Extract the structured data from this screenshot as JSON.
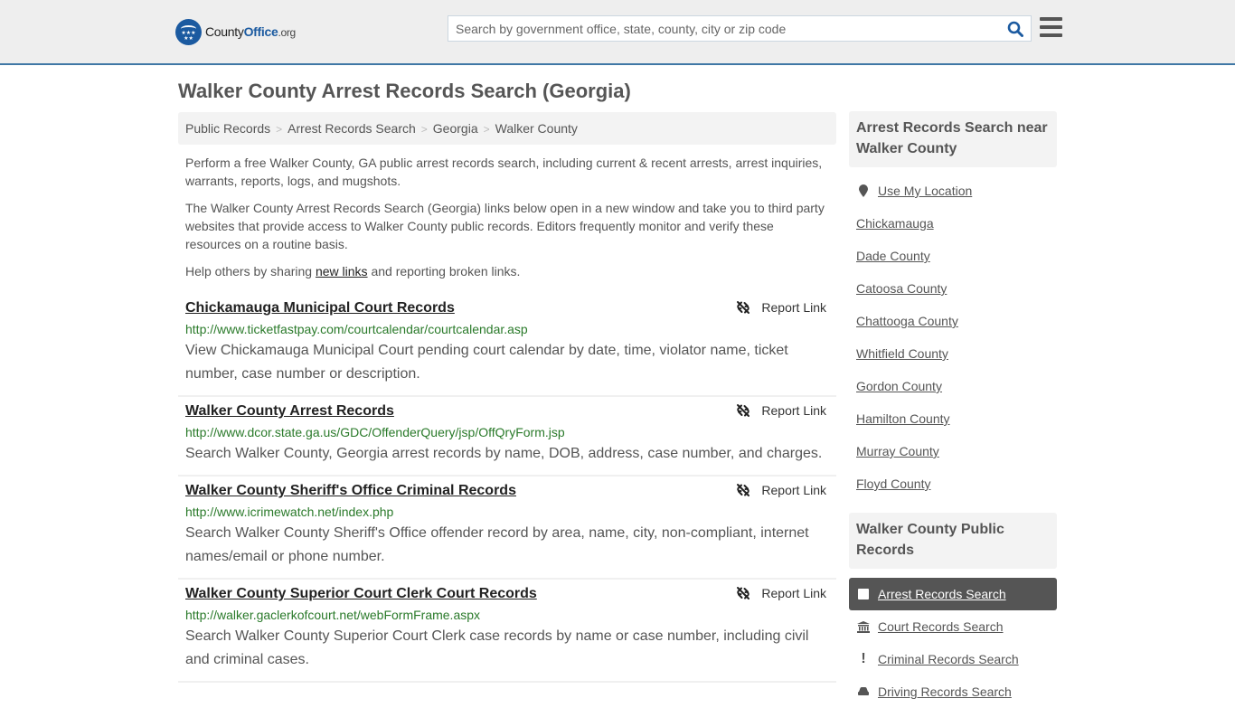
{
  "header": {
    "logo": {
      "brand_a": "County",
      "brand_b": "Office",
      "brand_c": ".org"
    },
    "search": {
      "placeholder": "Search by government office, state, county, city or zip code",
      "value": ""
    },
    "colors": {
      "accent": "#3f77a5",
      "brand": "#1b5aa0",
      "url_green": "#2a7a2a"
    }
  },
  "page": {
    "title": "Walker County Arrest Records Search (Georgia)"
  },
  "breadcrumb": [
    "Public Records",
    "Arrest Records Search",
    "Georgia",
    "Walker County"
  ],
  "intro": {
    "p1": "Perform a free Walker County, GA public arrest records search, including current & recent arrests, arrest inquiries, warrants, reports, logs, and mugshots.",
    "p2": "The Walker County Arrest Records Search (Georgia) links below open in a new window and take you to third party websites that provide access to Walker County public records. Editors frequently monitor and verify these resources on a routine basis.",
    "p3_before": "Help others by sharing ",
    "p3_link": "new links",
    "p3_after": " and reporting broken links."
  },
  "results": [
    {
      "title": "Chickamauga Municipal Court Records",
      "url": "http://www.ticketfastpay.com/courtcalendar/courtcalendar.asp",
      "description": "View Chickamauga Municipal Court pending court calendar by date, time, violator name, ticket number, case number or description.",
      "report_label": "Report Link"
    },
    {
      "title": "Walker County Arrest Records",
      "url": "http://www.dcor.state.ga.us/GDC/OffenderQuery/jsp/OffQryForm.jsp",
      "description": "Search Walker County, Georgia arrest records by name, DOB, address, case number, and charges.",
      "report_label": "Report Link"
    },
    {
      "title": "Walker County Sheriff's Office Criminal Records",
      "url": "http://www.icrimewatch.net/index.php",
      "description": "Search Walker County Sheriff's Office offender record by area, name, city, non-compliant, internet names/email or phone number.",
      "report_label": "Report Link"
    },
    {
      "title": "Walker County Superior Court Clerk Court Records",
      "url": "http://walker.gaclerkofcourt.net/webFormFrame.aspx",
      "description": "Search Walker County Superior Court Clerk case records by name or case number, including civil and criminal cases.",
      "report_label": "Report Link"
    }
  ],
  "sidebar": {
    "nearby_heading": "Arrest Records Search near Walker County",
    "use_location": "Use My Location",
    "nearby": [
      "Chickamauga",
      "Dade County",
      "Catoosa County",
      "Chattooga County",
      "Whitfield County",
      "Gordon County",
      "Hamilton County",
      "Murray County",
      "Floyd County"
    ],
    "public_heading": "Walker County Public Records",
    "public_records": [
      {
        "label": "Arrest Records Search",
        "icon": "square-icon",
        "active": true
      },
      {
        "label": "Court Records Search",
        "icon": "courthouse-icon",
        "active": false
      },
      {
        "label": "Criminal Records Search",
        "icon": "exclamation-icon",
        "active": false
      },
      {
        "label": "Driving Records Search",
        "icon": "car-icon",
        "active": false
      }
    ]
  }
}
